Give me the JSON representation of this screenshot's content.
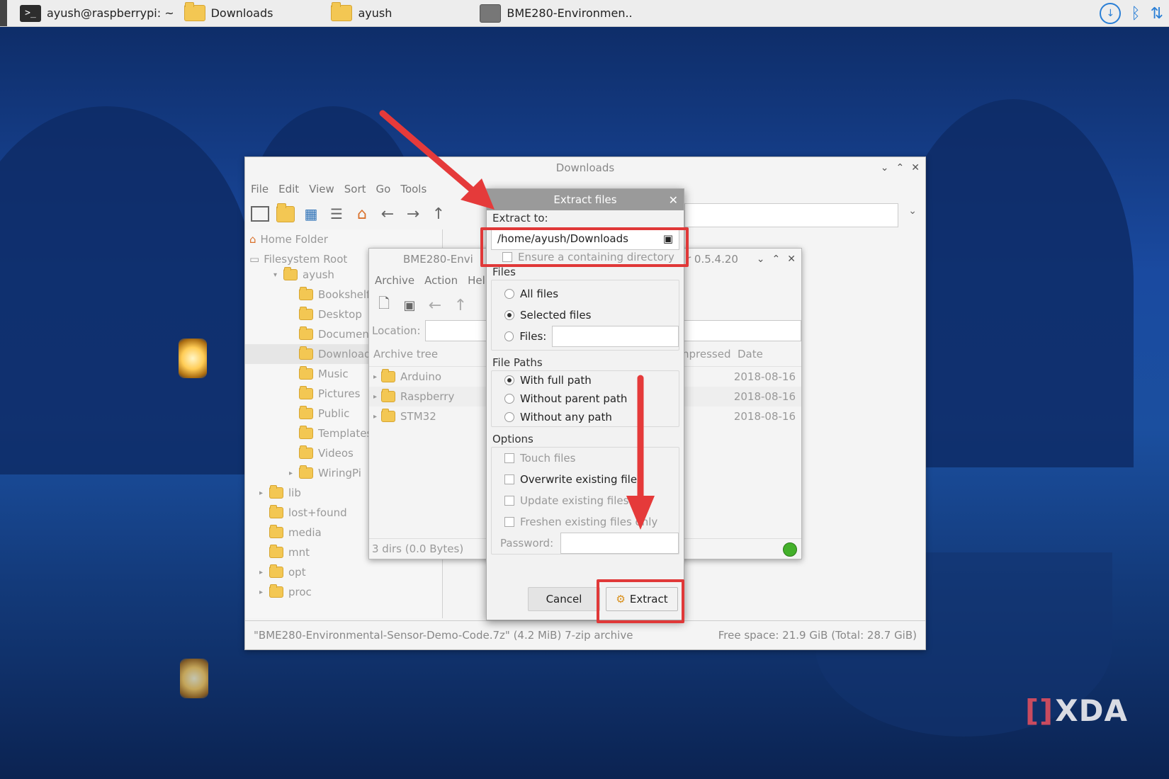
{
  "taskbar": {
    "items": [
      {
        "label": "ayush@raspberrypi: ~"
      },
      {
        "label": "Downloads"
      },
      {
        "label": "ayush"
      },
      {
        "label": "BME280-Environmen.."
      }
    ],
    "term_glyph": ">_"
  },
  "file_manager": {
    "title": "Downloads",
    "menu": [
      "File",
      "Edit",
      "View",
      "Sort",
      "Go",
      "Tools"
    ],
    "places": [
      {
        "label": "Home Folder"
      },
      {
        "label": "Filesystem Root"
      }
    ],
    "tree": [
      {
        "label": "ayush",
        "indent": 1
      },
      {
        "label": "Bookshelf",
        "indent": 2
      },
      {
        "label": "Desktop",
        "indent": 2
      },
      {
        "label": "Document",
        "indent": 2
      },
      {
        "label": "Download",
        "indent": 2
      },
      {
        "label": "Music",
        "indent": 2
      },
      {
        "label": "Pictures",
        "indent": 2
      },
      {
        "label": "Public",
        "indent": 2
      },
      {
        "label": "Templates",
        "indent": 2
      },
      {
        "label": "Videos",
        "indent": 2
      },
      {
        "label": "WiringPi",
        "indent": 2
      },
      {
        "label": "lib",
        "indent": 0
      },
      {
        "label": "lost+found",
        "indent": 0
      },
      {
        "label": "media",
        "indent": 0
      },
      {
        "label": "mnt",
        "indent": 0
      },
      {
        "label": "opt",
        "indent": 0
      },
      {
        "label": "proc",
        "indent": 0
      }
    ],
    "status_left": "\"BME280-Environmental-Sensor-Demo-Code.7z\" (4.2 MiB) 7-zip archive",
    "status_right": "Free space: 21.9 GiB (Total: 28.7 GiB)"
  },
  "archiver": {
    "title": "BME280-Envi",
    "title_right": "r 0.5.4.20",
    "menu": [
      "Archive",
      "Action",
      "Hel"
    ],
    "location_label": "Location:",
    "tree_header": "Archive tree",
    "col_compressed": "npressed",
    "col_date": "Date",
    "rows": [
      {
        "name": "Arduino",
        "date": "2018-08-16"
      },
      {
        "name": "Raspberry",
        "date": "2018-08-16"
      },
      {
        "name": "STM32",
        "date": "2018-08-16"
      }
    ],
    "status": "3 dirs  (0.0 Bytes)"
  },
  "dialog": {
    "title": "Extract files",
    "extract_to_label": "Extract to:",
    "extract_to_value": "/home/ayush/Downloads",
    "ensure_dir": "Ensure a containing directory",
    "files_label": "Files",
    "files_options": {
      "all": "All files",
      "selected": "Selected files",
      "files": "Files:"
    },
    "paths_label": "File Paths",
    "paths_options": {
      "full": "With full path",
      "parent": "Without parent path",
      "any": "Without any path"
    },
    "options_label": "Options",
    "options": {
      "touch": "Touch files",
      "overwrite": "Overwrite existing files",
      "update": "Update existing files",
      "freshen": "Freshen existing files only"
    },
    "password_label": "Password:",
    "cancel": "Cancel",
    "extract": "Extract"
  },
  "watermark": {
    "text": "XDA",
    "glyph": "[]"
  },
  "colors": {
    "highlight": "#e03838",
    "accent": "#2a7fd6"
  }
}
